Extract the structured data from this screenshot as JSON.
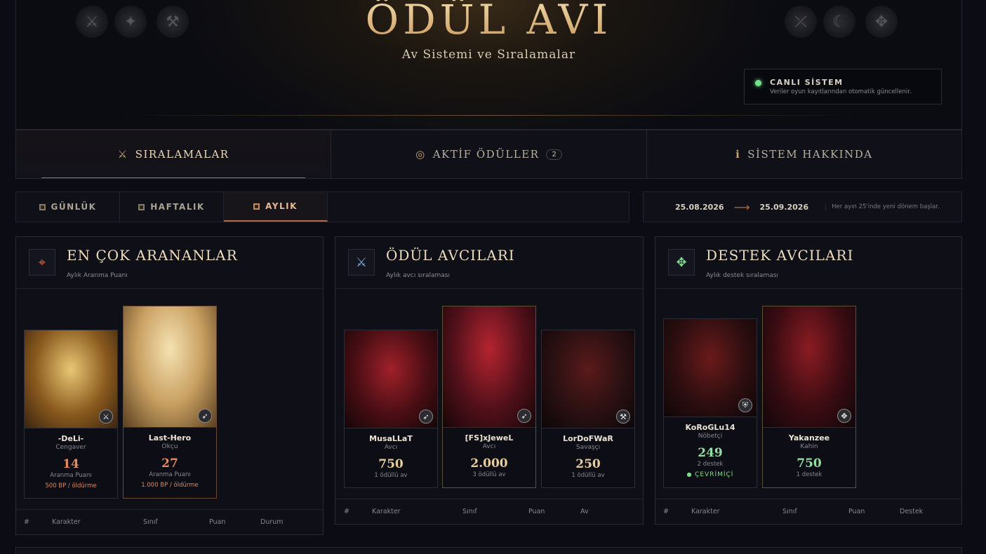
{
  "hero": {
    "title": "ÖDÜL AVI",
    "subtitle": "Av Sistemi ve Sıralamalar",
    "live_title": "CANLI SİSTEM",
    "live_desc": "Veriler oyun kayıtlarından otomatik güncellenir.",
    "live_color": "#79e08a"
  },
  "tabs": [
    {
      "label": "SIRALAMALAR",
      "icon": "crossed-swords-icon",
      "active": true
    },
    {
      "label": "AKTİF ÖDÜLLER",
      "icon": "target-ring-icon",
      "badge": "2"
    },
    {
      "label": "SİSTEM HAKKINDA",
      "icon": "info-icon"
    }
  ],
  "period": {
    "buttons": [
      "GÜNLÜK",
      "HAFTALIK",
      "AYLIK"
    ],
    "active": "AYLIK"
  },
  "dates": {
    "start": "25.08.2026",
    "end": "25.09.2026",
    "note": "Her ayın 25'inde yeni dönem başlar."
  },
  "panels": {
    "wanted": {
      "title": "EN ÇOK ARANANLAR",
      "subtitle": "Aylık Aranma Puanı",
      "icon": "crosshair-icon",
      "cards": [
        {
          "name": "-DeLi-",
          "class": "Cengaver",
          "score": "14",
          "score_label": "Aranma Puanı",
          "extra": "500 BP / öldürme"
        },
        {
          "name": "Last-Hero",
          "class": "Okçu",
          "score": "27",
          "score_label": "Aranma Puanı",
          "extra": "1.000 BP / öldürme"
        }
      ],
      "columns": [
        "#",
        "Karakter",
        "Sınıf",
        "Puan",
        "Durum"
      ]
    },
    "hunters": {
      "title": "ÖDÜL AVCILARI",
      "subtitle": "Aylık avcı sıralaması",
      "icon": "swords-icon",
      "cards": [
        {
          "name": "MusaLLaT",
          "class": "Avcı",
          "score": "750",
          "score_label": "1 ödüllü av"
        },
        {
          "name": "[FS]xJeweL",
          "class": "Avcı",
          "score": "2.000",
          "score_label": "3 ödüllü av"
        },
        {
          "name": "LorDoFWaR",
          "class": "Savaşçı",
          "score": "250",
          "score_label": "1 ödüllü av"
        }
      ],
      "columns": [
        "#",
        "Karakter",
        "Sınıf",
        "Puan",
        "Av"
      ]
    },
    "support": {
      "title": "DESTEK AVCILARI",
      "subtitle": "Aylık destek sıralaması",
      "icon": "support-arrows-icon",
      "cards": [
        {
          "name": "KoRoGLu14",
          "class": "Nöbetçi",
          "score": "249",
          "score_label": "2 destek",
          "online": "ÇEVRİMİÇİ"
        },
        {
          "name": "Yakanzee",
          "class": "Kahin",
          "score": "750",
          "score_label": "1 destek"
        }
      ],
      "columns": [
        "#",
        "Karakter",
        "Sınıf",
        "Puan",
        "Destek"
      ]
    }
  },
  "colors": {
    "accent": "#b66a3c",
    "gold": "#e2c690",
    "wanted_score": "#e88a5a",
    "hunter_score": "#e8cf9a",
    "support_score": "#8fe0a0"
  }
}
